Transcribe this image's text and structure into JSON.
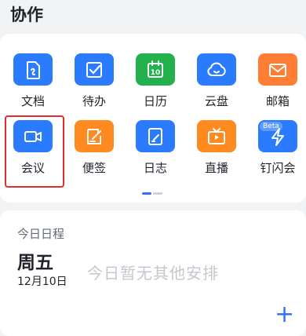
{
  "section": {
    "title": "协作"
  },
  "apps": [
    {
      "label": "文档",
      "icon": "docs-icon",
      "color": "#2b7bff"
    },
    {
      "label": "待办",
      "icon": "todo-icon",
      "color": "#2b7bff"
    },
    {
      "label": "日历",
      "icon": "calendar-icon",
      "color": "#22b14c",
      "day": "10"
    },
    {
      "label": "云盘",
      "icon": "cloud-drive-icon",
      "color": "#2b7bff"
    },
    {
      "label": "邮箱",
      "icon": "mail-icon",
      "color": "#ff7d34"
    },
    {
      "label": "会议",
      "icon": "video-meeting-icon",
      "color": "#2b7bff"
    },
    {
      "label": "便签",
      "icon": "notes-icon",
      "color": "#ff8a1f"
    },
    {
      "label": "日志",
      "icon": "journal-icon",
      "color": "#2b7bff"
    },
    {
      "label": "直播",
      "icon": "live-tv-icon",
      "color": "#ff8a1f"
    },
    {
      "label": "钉闪会",
      "icon": "flash-meeting-icon",
      "color": "#2b7bff",
      "badge": "Beta"
    }
  ],
  "schedule": {
    "label": "今日日程",
    "weekday": "周五",
    "date": "12月10日",
    "empty_message": "今日暂无其他安排",
    "add": "+"
  }
}
